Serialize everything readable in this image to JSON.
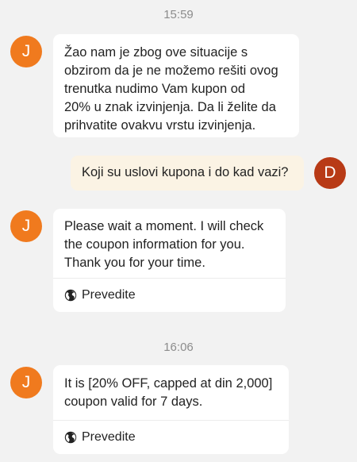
{
  "timestamps": [
    "15:59",
    "16:06"
  ],
  "agent_avatar_letter": "J",
  "user_avatar_letter": "D",
  "messages": [
    {
      "sender": "agent",
      "text": "Žao nam je zbog ove situacije s\nobzirom da je ne možemo rešiti ovog\ntrenutka nudimo Vam kupon od\n20% u znak izvinjenja. Da li želite da\nprihvatite ovakvu vrstu izvinjenja."
    },
    {
      "sender": "user",
      "text": "Koji su uslovi kupona i do kad vazi?"
    },
    {
      "sender": "agent",
      "text": "Please wait a moment. I will check\nthe coupon information for you.\nThank you for your time.",
      "translate_label": "Prevedite"
    },
    {
      "sender": "agent",
      "text": "It is [20% OFF, capped at  din 2,000]\ncoupon valid for 7 days.",
      "translate_label": "Prevedite"
    }
  ],
  "colors": {
    "agent_avatar": "#f07a1e",
    "user_avatar": "#b83a16",
    "sent_bubble": "#fbf3e4",
    "background": "#f2f2f2"
  },
  "icons": [
    "globe-icon"
  ]
}
